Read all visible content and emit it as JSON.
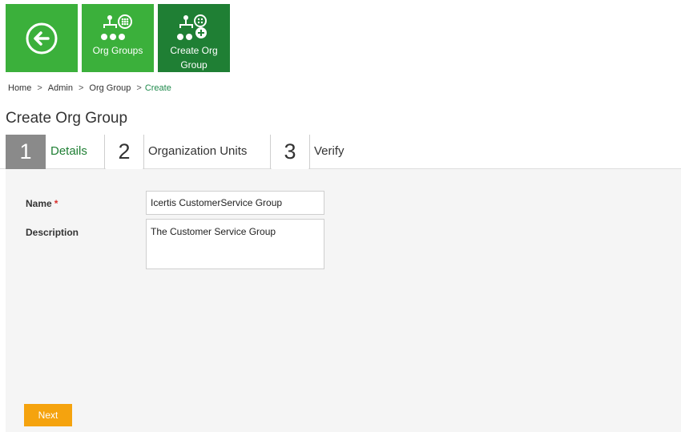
{
  "tiles": {
    "back": {
      "icon": "back-arrow-icon"
    },
    "org_groups": {
      "label": "Org Groups",
      "icon": "org-groups-icon"
    },
    "create_org_group": {
      "label": "Create Org Group",
      "icon": "create-org-group-icon"
    }
  },
  "breadcrumb": {
    "home": "Home",
    "admin": "Admin",
    "org_group": "Org Group",
    "current": "Create",
    "separator": ">"
  },
  "page_title": "Create Org Group",
  "steps": [
    {
      "number": "1",
      "label": "Details",
      "state": "active"
    },
    {
      "number": "2",
      "label": "Organization Units",
      "state": "inactive"
    },
    {
      "number": "3",
      "label": "Verify",
      "state": "inactive"
    }
  ],
  "form": {
    "name": {
      "label": "Name",
      "required_marker": "*",
      "value": "Icertis CustomerService Group"
    },
    "description": {
      "label": "Description",
      "value": "The Customer Service Group"
    }
  },
  "actions": {
    "next_label": "Next"
  },
  "colors": {
    "tile_green": "#3bb03b",
    "tile_active_green": "#1f7f34",
    "active_step": "#8a8a8a",
    "next_button": "#f5a30e",
    "required": "#d9302c"
  }
}
